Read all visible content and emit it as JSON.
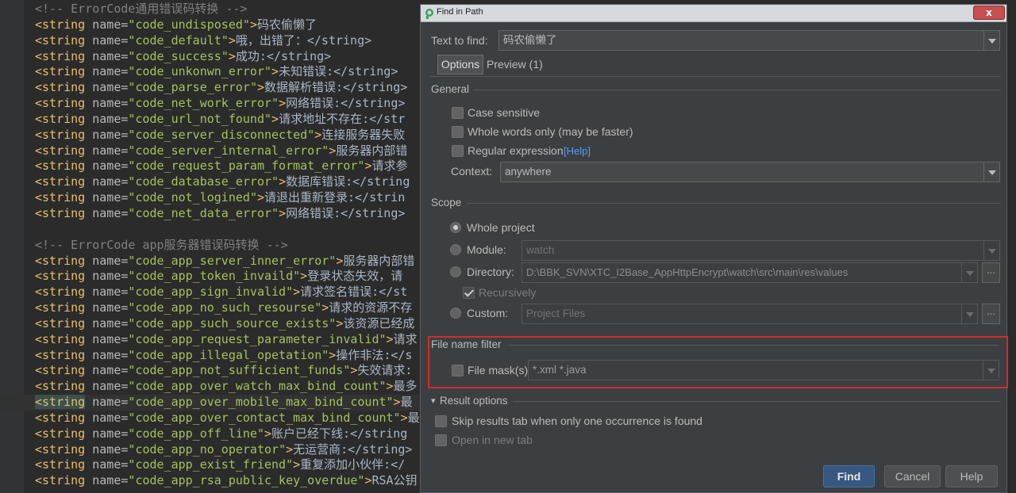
{
  "editor": {
    "lines": [
      {
        "kind": "comment",
        "text": "<!-- ErrorCode通用错误码转换 -->"
      },
      {
        "kind": "string",
        "name": "code_undisposed",
        "value": "码农偷懒了"
      },
      {
        "kind": "string",
        "name": "code_default",
        "value": "哦，出错了：</string>"
      },
      {
        "kind": "string",
        "name": "code_success",
        "value": "成功:</string>"
      },
      {
        "kind": "string",
        "name": "code_unkonwn_error",
        "value": "未知错误:</string>"
      },
      {
        "kind": "string",
        "name": "code_parse_error",
        "value": "数据解析错误:</string>"
      },
      {
        "kind": "string",
        "name": "code_net_work_error",
        "value": "网络错误:</string>"
      },
      {
        "kind": "string",
        "name": "code_url_not_found",
        "value": "请求地址不存在:</str"
      },
      {
        "kind": "string",
        "name": "code_server_disconnected",
        "value": "连接服务器失败"
      },
      {
        "kind": "string",
        "name": "code_server_internal_error",
        "value": "服务器内部错"
      },
      {
        "kind": "string",
        "name": "code_request_param_format_error",
        "value": "请求参"
      },
      {
        "kind": "string",
        "name": "code_database_error",
        "value": "数据库错误:</string"
      },
      {
        "kind": "string",
        "name": "code_not_logined",
        "value": "请退出重新登录:</strin"
      },
      {
        "kind": "string",
        "name": "code_net_data_error",
        "value": "网络错误:</string>"
      },
      {
        "kind": "blank",
        "text": ""
      },
      {
        "kind": "comment",
        "text": "<!-- ErrorCode app服务器错误码转换 -->"
      },
      {
        "kind": "string",
        "name": "code_app_server_inner_error",
        "value": "服务器内部错"
      },
      {
        "kind": "string",
        "name": "code_app_token_invaild",
        "value": "登录状态失效，请"
      },
      {
        "kind": "string",
        "name": "code_app_sign_invalid",
        "value": "请求签名错误:</st"
      },
      {
        "kind": "string",
        "name": "code_app_no_such_resourse",
        "value": "请求的资源不存"
      },
      {
        "kind": "string",
        "name": "code_app_such_source_exists",
        "value": "该资源已经成"
      },
      {
        "kind": "string",
        "name": "code_app_request_parameter_invalid",
        "value": "请求"
      },
      {
        "kind": "string",
        "name": "code_app_illegal_opetation",
        "value": "操作非法:</s"
      },
      {
        "kind": "string",
        "name": "code_app_not_sufficient_funds",
        "value": "失效请求:"
      },
      {
        "kind": "string",
        "name": "code_app_over_watch_max_bind_count",
        "value": "最多"
      },
      {
        "kind": "string",
        "name": "code_app_over_mobile_max_bind_count",
        "value": "最",
        "highlight": true
      },
      {
        "kind": "string",
        "name": "code_app_over_contact_max_bind_count",
        "value": "最"
      },
      {
        "kind": "string",
        "name": "code_app_off_line",
        "value": "账户已经下线:</string"
      },
      {
        "kind": "string",
        "name": "code_app_no_operator",
        "value": "无运营商:</string>"
      },
      {
        "kind": "string",
        "name": "code_app_exist_friend",
        "value": "重复添加小伙伴:</"
      },
      {
        "kind": "string",
        "name": "code_app_rsa_public_key_overdue",
        "value": "RSA公钥"
      }
    ]
  },
  "dialog": {
    "title": "Find in Path",
    "close_label": "x",
    "text_to_find_label": "Text to find:",
    "text_to_find_value": "码农偷懒了",
    "tabs": [
      {
        "label": "Options",
        "selected": true
      },
      {
        "label": "Preview (1)",
        "selected": false
      }
    ],
    "general": {
      "heading": "General",
      "case_sensitive": "Case sensitive",
      "whole_words": "Whole words only (may be faster)",
      "regex": "Regular expression",
      "regex_help": "[Help]",
      "context_label": "Context:",
      "context_value": "anywhere"
    },
    "scope": {
      "heading": "Scope",
      "whole_project": "Whole project",
      "module_label": "Module:",
      "module_value": "watch",
      "directory_label": "Directory:",
      "directory_value": "D:\\BBK_SVN\\XTC_I2Base_AppHttpEncrypt\\watch\\src\\main\\res\\values",
      "recursively": "Recursively",
      "custom_label": "Custom:",
      "custom_value": "Project Files",
      "browse_label": "..."
    },
    "file_filter": {
      "heading": "File name filter",
      "mask_label": "File mask(s)",
      "mask_value": "*.xml *.java"
    },
    "result_options": {
      "heading": "Result options",
      "skip_tab": "Skip results tab when only one occurrence is found",
      "new_tab": "Open in new tab"
    },
    "buttons": {
      "find": "Find",
      "cancel": "Cancel",
      "help": "Help"
    }
  }
}
